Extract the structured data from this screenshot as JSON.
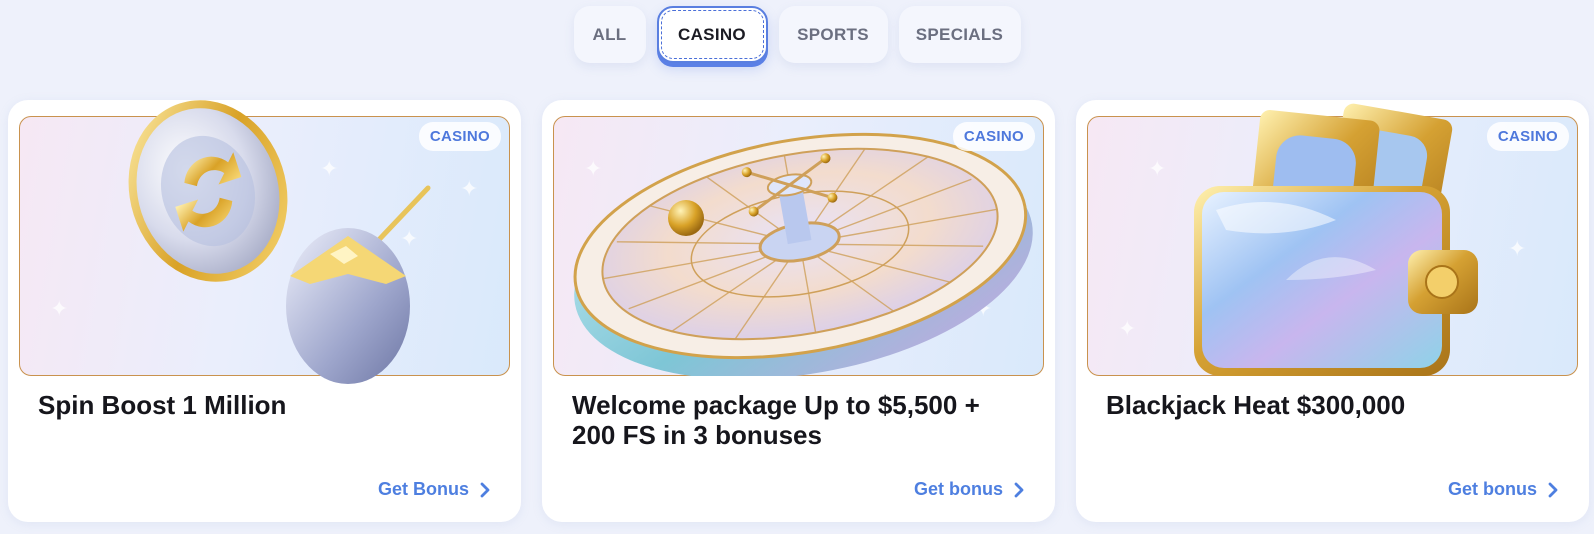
{
  "tabs": [
    {
      "label": "ALL",
      "active": false
    },
    {
      "label": "CASINO",
      "active": true
    },
    {
      "label": "SPORTS",
      "active": false
    },
    {
      "label": "SPECIALS",
      "active": false
    }
  ],
  "cards": [
    {
      "badge": "CASINO",
      "title": "Spin Boost 1 Million",
      "cta": "Get Bonus",
      "image_icon": "coin-and-coconut-icon"
    },
    {
      "badge": "CASINO",
      "title": "Welcome package Up to $5,500 + 200 FS in 3 bonuses",
      "cta": "Get bonus",
      "image_icon": "roulette-wheel-icon"
    },
    {
      "badge": "CASINO",
      "title": "Blackjack Heat $300,000",
      "cta": "Get bonus",
      "image_icon": "wallet-icon"
    }
  ],
  "colors": {
    "accent": "#4e7fe0",
    "badge_text": "#4e78dc",
    "banner_border": "#c9924e",
    "page_bg": "#eef1fb"
  }
}
